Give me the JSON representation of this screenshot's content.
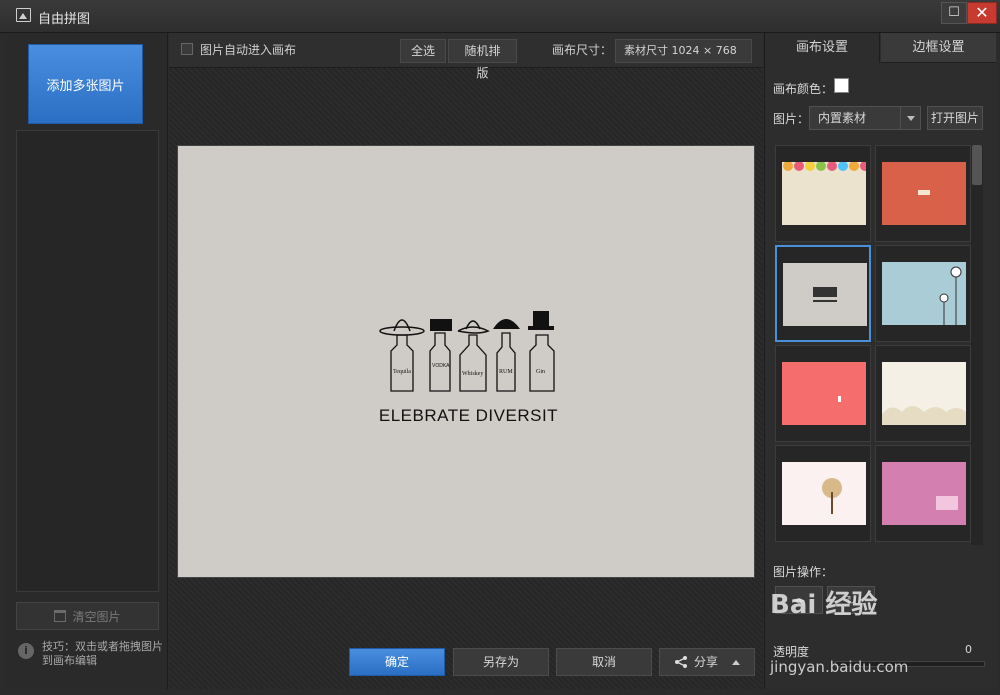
{
  "window": {
    "title": "自由拼图",
    "max_glyph": "☐",
    "close_glyph": "✕"
  },
  "left": {
    "add_button": "添加多张图片",
    "clear_button": "清空图片",
    "tip": "技巧：双击或者拖拽图片到画布编辑"
  },
  "toolbar": {
    "auto_enter_label": "图片自动进入画布",
    "select_all": "全选",
    "random_layout": "随机排版",
    "canvas_size_label": "画布尺寸：",
    "canvas_size_value": "素材尺寸  1024  ×  768"
  },
  "canvas": {
    "artwork_caption": "CELEBRATE DIVERSITY",
    "bottle_labels": [
      "Tequila",
      "VODKA",
      "Whiskey",
      "RUM",
      "Gin"
    ]
  },
  "bottom": {
    "ok": "确定",
    "save_as": "另存为",
    "cancel": "取消",
    "share": "分享"
  },
  "right": {
    "tabs": [
      "画布设置",
      "边框设置"
    ],
    "canvas_color_label": "画布颜色：",
    "canvas_color": "#ffffff",
    "picture_label": "图片：",
    "picture_select": "内置素材",
    "open_picture": "打开图片",
    "image_ops_label": "图片操作：",
    "opacity_label": "透明度",
    "opacity_value": "0"
  },
  "watermark": {
    "brand": "Bai 经验",
    "url": "jingyan.baidu.com"
  }
}
